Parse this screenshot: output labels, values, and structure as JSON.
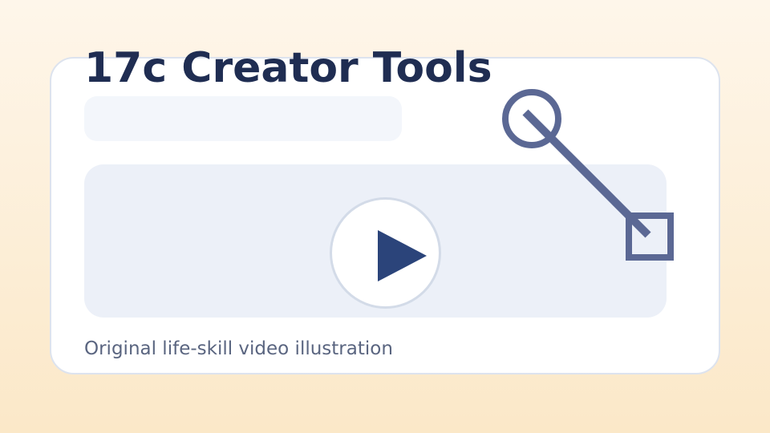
{
  "header": {
    "title": "17c Creator Tools"
  },
  "search": {
    "placeholder": ""
  },
  "video": {
    "caption": "Original life-skill video illustration",
    "play_icon": "play-icon"
  },
  "decoration": {
    "tool_icon": "magnifier-connector-icon"
  },
  "colors": {
    "title": "#1f2d52",
    "accent": "#2b447a",
    "icon": "#5b6894",
    "card_border": "#dde3ee",
    "panel": "#ecf0f8",
    "background_top": "#fef6ea",
    "background_bottom": "#fbe8c8"
  }
}
